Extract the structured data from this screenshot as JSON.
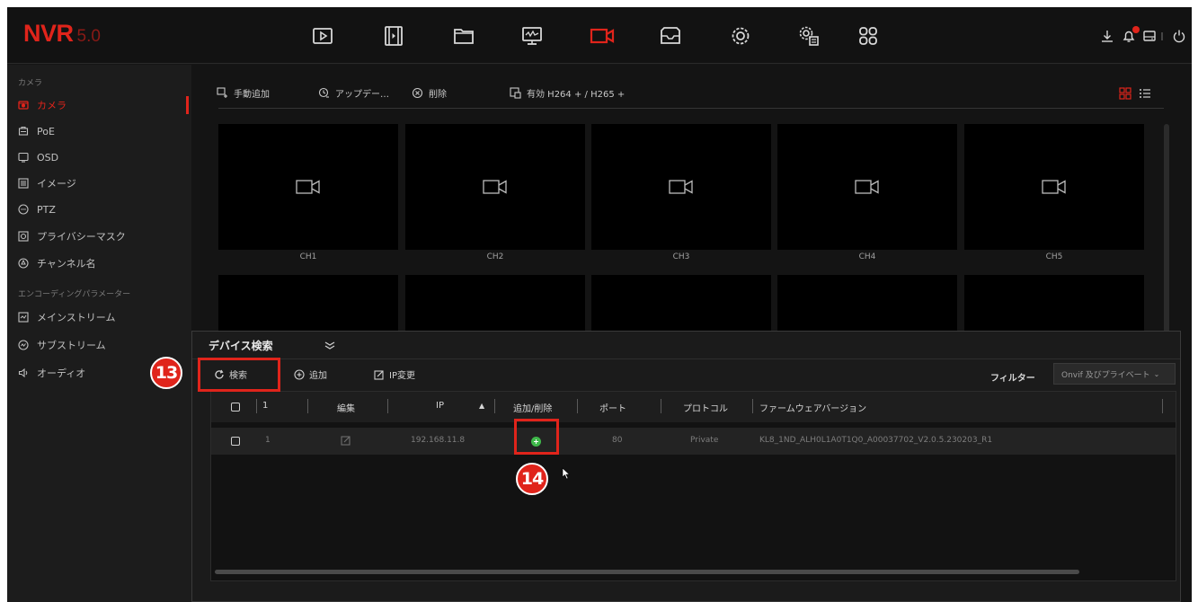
{
  "app": {
    "brand": "NVR",
    "version": "5.0"
  },
  "colors": {
    "accent": "#e0241b",
    "background": "#151515",
    "add_green": "#3fb84a"
  },
  "topnav": {
    "icons": [
      "playback-icon",
      "video-clips-icon",
      "folder-icon",
      "monitor-icon",
      "camera-icon",
      "storage-icon",
      "settings-icon",
      "system-settings-icon",
      "apps-grid-icon"
    ],
    "active": "camera-icon",
    "right_icons": [
      "download-icon",
      "alarm-bell-icon",
      "storage-disk-icon",
      "power-icon"
    ]
  },
  "sidebar": {
    "section1": "カメラ",
    "items": [
      {
        "label": "カメラ",
        "icon": "camera-icon",
        "active": true
      },
      {
        "label": "PoE",
        "icon": "poe-icon"
      },
      {
        "label": "OSD",
        "icon": "osd-icon"
      },
      {
        "label": "イメージ",
        "icon": "image-icon"
      },
      {
        "label": "PTZ",
        "icon": "ptz-icon"
      },
      {
        "label": "プライバシーマスク",
        "icon": "privacy-mask-icon"
      },
      {
        "label": "チャンネル名",
        "icon": "channel-name-icon"
      }
    ],
    "section2": "エンコーディングパラメーター",
    "items2": [
      {
        "label": "メインストリーム",
        "icon": "main-stream-icon"
      },
      {
        "label": "サブストリーム",
        "icon": "sub-stream-icon"
      },
      {
        "label": "オーディオ",
        "icon": "audio-icon"
      }
    ]
  },
  "toolbar": {
    "manual_add": "手動追加",
    "update": "アップデー…",
    "delete": "削除",
    "enable_codec": "有効 H264 + / H265 +"
  },
  "channels": [
    "CH1",
    "CH2",
    "CH3",
    "CH4",
    "CH5"
  ],
  "dialog": {
    "title": "デバイス検索",
    "search": "検索",
    "add": "追加",
    "ip_change": "IP変更",
    "filter_label": "フィルター",
    "filter_value": "Onvif 及びプライベート"
  },
  "table": {
    "headers": {
      "count": "1",
      "edit": "編集",
      "ip": "IP",
      "add_del": "追加/削除",
      "port": "ポート",
      "protocol": "プロトコル",
      "firmware": "ファームウェアバージョン"
    },
    "rows": [
      {
        "no": "1",
        "ip": "192.168.11.8",
        "port": "80",
        "protocol": "Private",
        "firmware": "KL8_1ND_ALH0L1A0T1Q0_A00037702_V2.0.5.230203_R1"
      }
    ]
  },
  "annotations": {
    "step13": "13",
    "step14": "14"
  }
}
